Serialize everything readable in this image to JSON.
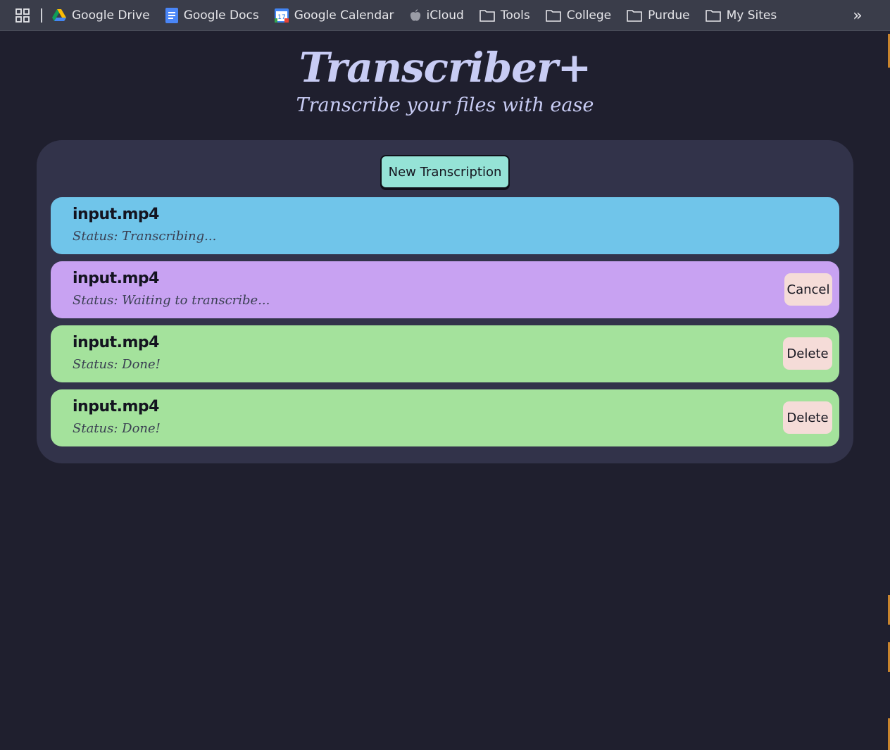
{
  "bookmarks_bar": {
    "items": [
      {
        "label": "Google Drive",
        "icon": "google-drive-icon"
      },
      {
        "label": "Google Docs",
        "icon": "google-docs-icon"
      },
      {
        "label": "Google Calendar",
        "icon": "google-calendar-icon",
        "badge": "17"
      },
      {
        "label": "iCloud",
        "icon": "apple-icon"
      },
      {
        "label": "Tools",
        "icon": "folder-icon"
      },
      {
        "label": "College",
        "icon": "folder-icon"
      },
      {
        "label": "Purdue",
        "icon": "folder-icon"
      },
      {
        "label": "My Sites",
        "icon": "folder-icon"
      }
    ],
    "overflow_glyph": "»"
  },
  "header": {
    "title": "Transcriber+",
    "subtitle": "Transcribe your files with ease"
  },
  "panel": {
    "new_button_label": "New Transcription",
    "jobs": [
      {
        "name": "input.mp4",
        "status": "Status: Transcribing...",
        "color": "#70c5ea",
        "action": ""
      },
      {
        "name": "input.mp4",
        "status": "Status: Waiting to transcribe...",
        "color": "#c8a2f2",
        "action": "Cancel"
      },
      {
        "name": "input.mp4",
        "status": "Status: Done!",
        "color": "#a4e29c",
        "action": "Delete"
      },
      {
        "name": "input.mp4",
        "status": "Status: Done!",
        "color": "#a4e29c",
        "action": "Delete"
      }
    ]
  },
  "colors": {
    "page_background": "#1f1f2e",
    "panel_background": "#32334a",
    "title_color": "#c8ccf4",
    "new_button": "#95e3d6",
    "action_button": "#f5dcd8"
  }
}
